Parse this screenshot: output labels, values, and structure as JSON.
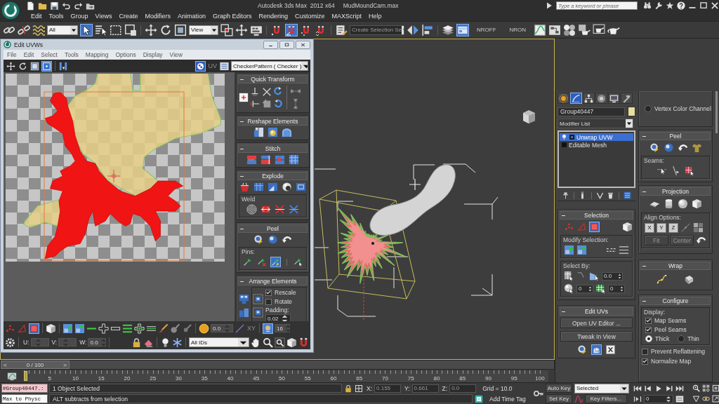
{
  "title_bar": {
    "title": "Autodesk 3ds Max  2012 x64",
    "file_name": "MudMoundCam.max",
    "search": {
      "placeholder": "Type a keyword or phrase"
    }
  },
  "menu_bar": [
    "Edit",
    "Tools",
    "Group",
    "Views",
    "Create",
    "Modifiers",
    "Animation",
    "Graph Editors",
    "Rendering",
    "Customize",
    "MAXScript",
    "Help"
  ],
  "main_toolbar": {
    "selection_filter": "All",
    "select_object": {
      "selected": true
    },
    "reference_coordinate_system": "View",
    "snaps": [
      {
        "on": false
      },
      {
        "on": true
      },
      {
        "on": false
      },
      {
        "on": false
      }
    ],
    "named_selection_set": "Create Selection Se",
    "ribbon_toggle": {
      "on": true
    },
    "labels": [
      "NROFF",
      "NRON"
    ]
  },
  "edit_uvws": {
    "title": "Edit UVWs",
    "menu": [
      "File",
      "Edit",
      "Select",
      "Tools",
      "Mapping",
      "Options",
      "Display",
      "View"
    ],
    "transform_modes": [
      {
        "selected": false
      },
      {
        "selected": false
      },
      {
        "selected": false
      },
      {
        "selected": true
      }
    ],
    "checker_toggle": {
      "on": true
    },
    "uv_label": "UV",
    "texture": "CheckerPattern  ( Checker )",
    "quick_transform": {
      "title": "Quick Transform"
    },
    "reshape_elements": {
      "title": "Reshape Elements"
    },
    "stitch": {
      "title": "Stitch"
    },
    "explode": {
      "title": "Explode",
      "weld_label": "Weld"
    },
    "peel": {
      "title": "Peel",
      "pins_label": "Pins:",
      "pin_tools": [
        {
          "on": false
        },
        {
          "on": false
        },
        {
          "on": true
        },
        {
          "on": false
        }
      ]
    },
    "arrange_elements": {
      "title": "Arrange Elements",
      "options": [
        {
          "label": "Rescale",
          "checked": true
        },
        {
          "label": "Rotate",
          "checked": false
        }
      ],
      "padding": {
        "label": "Padding:",
        "value": "0.02"
      }
    },
    "subobject_modes": [
      {
        "selected": false
      },
      {
        "selected": false
      },
      {
        "selected": true
      }
    ],
    "soft_selection": "0.0",
    "axis_label": "XY",
    "snap_toggle": {
      "on": true
    },
    "snap_value": "16",
    "coordinates": [
      {
        "label": "U:"
      },
      {
        "label": "V:"
      },
      {
        "label": "W:",
        "value": "0.0"
      }
    ],
    "id_filter": "All IDs"
  },
  "command_panel": {
    "tabs": [
      {
        "selected": false
      },
      {
        "selected": true
      },
      {
        "selected": false
      },
      {
        "selected": false
      },
      {
        "selected": false
      },
      {
        "selected": false
      }
    ],
    "object_name": "Group40447",
    "modifier_list": "Modifier List",
    "modifier_stack": [
      {
        "label": "Unwrap UVW",
        "selected": true
      },
      {
        "label": "Editable Mesh",
        "selected": false
      }
    ],
    "selection": {
      "title": "Selection",
      "subobject_modes": [
        {
          "selected": false
        },
        {
          "selected": false
        },
        {
          "selected": true
        }
      ],
      "modify_selection_label": "Modify Selection:",
      "select_by_label": "Select By:",
      "select_by_values": [
        "0.0",
        "0",
        "0"
      ]
    },
    "edit_uvs": {
      "title": "Edit UVs",
      "buttons": [
        "Open UV Editor ...",
        "Tweak In View"
      ],
      "tweak_toggle": {
        "on": true
      }
    },
    "channel_options": [
      {
        "label": "Vertex Color Channel",
        "selected": false
      }
    ],
    "peel": {
      "title": "Peel",
      "seams_label": "Seams:"
    },
    "projection": {
      "title": "Projection",
      "align_label": "Align Options:",
      "axes": [
        "X",
        "Y",
        "Z"
      ],
      "buttons": [
        {
          "label": "Fit",
          "disabled": true
        },
        {
          "label": "Center",
          "disabled": true
        }
      ]
    },
    "wrap": {
      "title": "Wrap"
    },
    "configure": {
      "title": "Configure",
      "display_label": "Display:",
      "display_options": [
        {
          "label": "Map Seams",
          "checked": true
        },
        {
          "label": "Peel Seams",
          "checked": true
        }
      ],
      "thickness": [
        {
          "label": "Thick",
          "selected": true
        },
        {
          "label": "Thin",
          "selected": false
        }
      ],
      "options": [
        {
          "label": "Prevent Reflattening",
          "checked": false
        },
        {
          "label": "Normalize Map",
          "checked": true
        }
      ]
    }
  },
  "time_slider": {
    "previous": "<",
    "position": "0 / 100",
    "next": ">",
    "level": 0
  },
  "trackbar": {
    "ticks": [
      "5",
      "10",
      "15",
      "20",
      "25",
      "30",
      "35",
      "40",
      "45",
      "50",
      "55",
      "60",
      "65",
      "70",
      "75",
      "80",
      "85",
      "90",
      "95",
      "100"
    ]
  },
  "status_bar": {
    "listener": [
      "#Group40447.:",
      "Max to Physc"
    ],
    "selection_info": "1 Object Selected",
    "prompt": "ALT subtracts from selection",
    "coordinates": [
      {
        "label": "X:",
        "value": "0.155",
        "disabled": true
      },
      {
        "label": "Y:",
        "value": "0.661",
        "disabled": true
      },
      {
        "label": "Z:",
        "value": "0.0",
        "disabled": true
      }
    ],
    "grid": "Grid = 10.0",
    "time_tag": "Add Time Tag",
    "auto_key": "Auto Key",
    "key_mode": "Selected",
    "set_key": "Set Key",
    "key_filters": "Key Filters...",
    "frame": "0"
  }
}
